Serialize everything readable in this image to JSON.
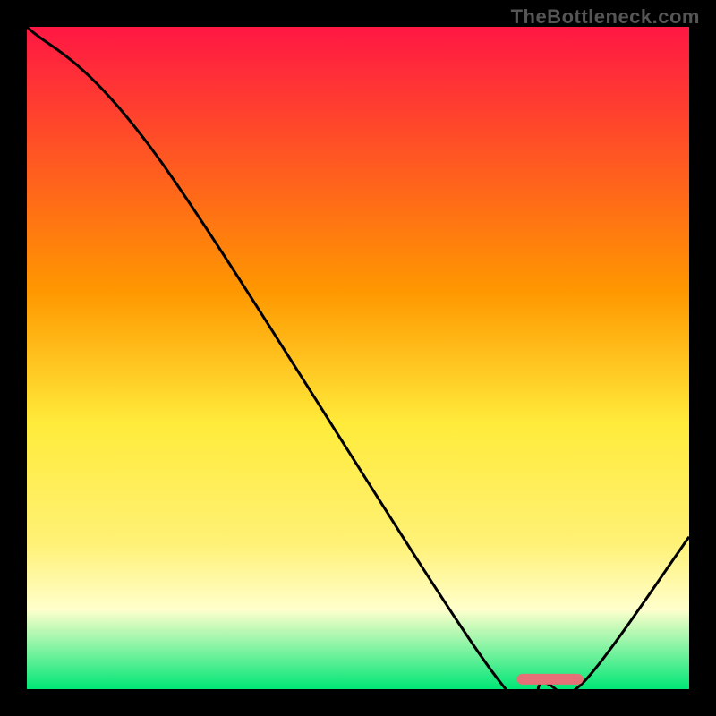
{
  "watermark": "TheBottleneck.com",
  "chart_data": {
    "type": "line",
    "title": "",
    "xlabel": "",
    "ylabel": "",
    "xlim": [
      0,
      100
    ],
    "ylim": [
      0,
      100
    ],
    "gradient_stops": [
      {
        "offset": 0,
        "color": "#ff1744"
      },
      {
        "offset": 40,
        "color": "#ff9800"
      },
      {
        "offset": 60,
        "color": "#ffeb3b"
      },
      {
        "offset": 78,
        "color": "#fff176"
      },
      {
        "offset": 88,
        "color": "#ffffcc"
      },
      {
        "offset": 100,
        "color": "#00e676"
      }
    ],
    "series": [
      {
        "name": "bottleneck-curve",
        "color": "#000000",
        "points": [
          {
            "x": 0,
            "y": 100
          },
          {
            "x": 20,
            "y": 80
          },
          {
            "x": 70,
            "y": 3
          },
          {
            "x": 78,
            "y": 1
          },
          {
            "x": 84,
            "y": 1
          },
          {
            "x": 100,
            "y": 23
          }
        ]
      }
    ],
    "marker": {
      "name": "optimal-range",
      "color": "#e67077",
      "y": 1.5,
      "x_start": 74,
      "x_end": 84,
      "thickness": 12
    }
  }
}
